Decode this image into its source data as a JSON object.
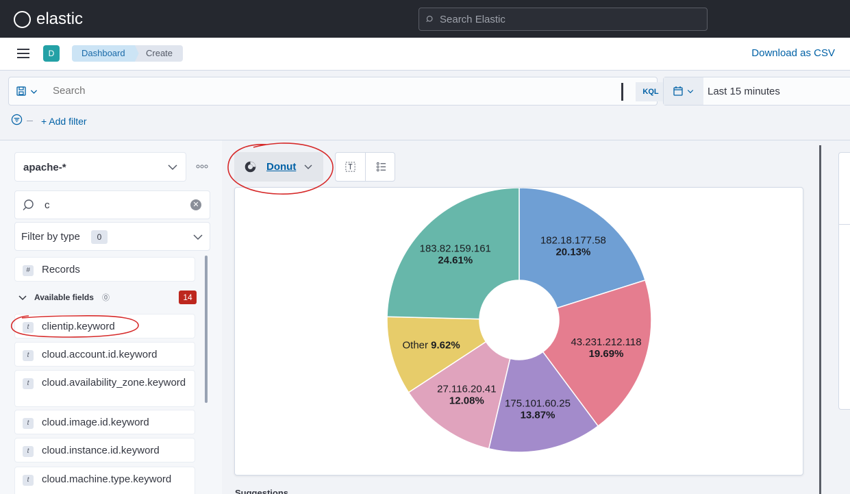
{
  "header": {
    "logo_text": "elastic",
    "search_placeholder": "Search Elastic"
  },
  "navbar": {
    "space_initial": "D",
    "breadcrumbs": [
      "Dashboard",
      "Create"
    ],
    "download_label": "Download as CSV"
  },
  "querybar": {
    "placeholder": "Search",
    "language": "KQL",
    "time_range": "Last 15 minutes",
    "add_filter_label": "+ Add filter"
  },
  "sidebar": {
    "index_pattern": "apache-*",
    "field_search_value": "c",
    "filter_by_type_label": "Filter by type",
    "filter_by_type_count": "0",
    "records_label": "Records",
    "available_fields_label": "Available fields",
    "available_fields_count": "14",
    "fields": [
      "clientip.keyword",
      "cloud.account.id.keyword",
      "cloud.availability_zone.keyword",
      "cloud.image.id.keyword",
      "cloud.instance.id.keyword",
      "cloud.machine.type.keyword"
    ]
  },
  "workspace": {
    "chart_type_label": "Donut",
    "suggestions_label": "Suggestions"
  },
  "colors": {
    "accent": "#0061a6",
    "header_bg": "#25282f",
    "badge_red": "#bd271e",
    "annotation_red": "#d62a2a"
  },
  "chart_data": {
    "type": "pie",
    "variant": "donut",
    "slices": [
      {
        "label": "182.18.177.58",
        "value": 20.13,
        "color": "#6f9fd4"
      },
      {
        "label": "43.231.212.118",
        "value": 19.69,
        "color": "#e57d8f"
      },
      {
        "label": "175.101.60.25",
        "value": 13.87,
        "color": "#a38bcb"
      },
      {
        "label": "27.116.20.41",
        "value": 12.08,
        "color": "#e0a3bd"
      },
      {
        "label": "Other",
        "value": 9.62,
        "color": "#e7cc6a"
      },
      {
        "label": "183.82.159.161",
        "value": 24.61,
        "color": "#67b7aa"
      }
    ],
    "value_format": "percent"
  }
}
